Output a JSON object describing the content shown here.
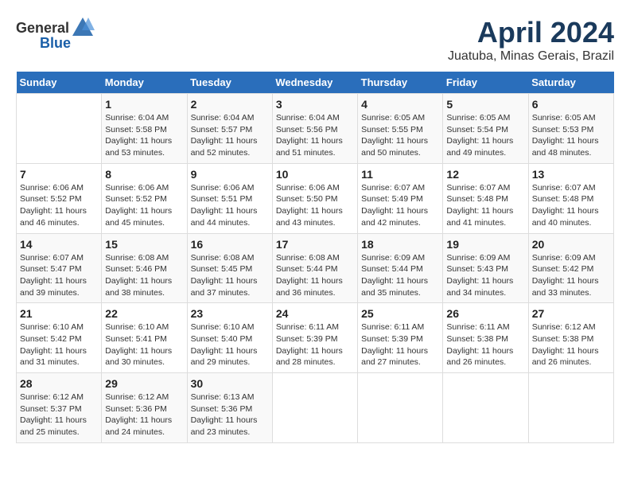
{
  "header": {
    "logo_general": "General",
    "logo_blue": "Blue",
    "title": "April 2024",
    "subtitle": "Juatuba, Minas Gerais, Brazil"
  },
  "columns": [
    "Sunday",
    "Monday",
    "Tuesday",
    "Wednesday",
    "Thursday",
    "Friday",
    "Saturday"
  ],
  "weeks": [
    [
      {
        "day": "",
        "info": ""
      },
      {
        "day": "1",
        "info": "Sunrise: 6:04 AM\nSunset: 5:58 PM\nDaylight: 11 hours\nand 53 minutes."
      },
      {
        "day": "2",
        "info": "Sunrise: 6:04 AM\nSunset: 5:57 PM\nDaylight: 11 hours\nand 52 minutes."
      },
      {
        "day": "3",
        "info": "Sunrise: 6:04 AM\nSunset: 5:56 PM\nDaylight: 11 hours\nand 51 minutes."
      },
      {
        "day": "4",
        "info": "Sunrise: 6:05 AM\nSunset: 5:55 PM\nDaylight: 11 hours\nand 50 minutes."
      },
      {
        "day": "5",
        "info": "Sunrise: 6:05 AM\nSunset: 5:54 PM\nDaylight: 11 hours\nand 49 minutes."
      },
      {
        "day": "6",
        "info": "Sunrise: 6:05 AM\nSunset: 5:53 PM\nDaylight: 11 hours\nand 48 minutes."
      }
    ],
    [
      {
        "day": "7",
        "info": "Sunrise: 6:06 AM\nSunset: 5:52 PM\nDaylight: 11 hours\nand 46 minutes."
      },
      {
        "day": "8",
        "info": "Sunrise: 6:06 AM\nSunset: 5:52 PM\nDaylight: 11 hours\nand 45 minutes."
      },
      {
        "day": "9",
        "info": "Sunrise: 6:06 AM\nSunset: 5:51 PM\nDaylight: 11 hours\nand 44 minutes."
      },
      {
        "day": "10",
        "info": "Sunrise: 6:06 AM\nSunset: 5:50 PM\nDaylight: 11 hours\nand 43 minutes."
      },
      {
        "day": "11",
        "info": "Sunrise: 6:07 AM\nSunset: 5:49 PM\nDaylight: 11 hours\nand 42 minutes."
      },
      {
        "day": "12",
        "info": "Sunrise: 6:07 AM\nSunset: 5:48 PM\nDaylight: 11 hours\nand 41 minutes."
      },
      {
        "day": "13",
        "info": "Sunrise: 6:07 AM\nSunset: 5:48 PM\nDaylight: 11 hours\nand 40 minutes."
      }
    ],
    [
      {
        "day": "14",
        "info": "Sunrise: 6:07 AM\nSunset: 5:47 PM\nDaylight: 11 hours\nand 39 minutes."
      },
      {
        "day": "15",
        "info": "Sunrise: 6:08 AM\nSunset: 5:46 PM\nDaylight: 11 hours\nand 38 minutes."
      },
      {
        "day": "16",
        "info": "Sunrise: 6:08 AM\nSunset: 5:45 PM\nDaylight: 11 hours\nand 37 minutes."
      },
      {
        "day": "17",
        "info": "Sunrise: 6:08 AM\nSunset: 5:44 PM\nDaylight: 11 hours\nand 36 minutes."
      },
      {
        "day": "18",
        "info": "Sunrise: 6:09 AM\nSunset: 5:44 PM\nDaylight: 11 hours\nand 35 minutes."
      },
      {
        "day": "19",
        "info": "Sunrise: 6:09 AM\nSunset: 5:43 PM\nDaylight: 11 hours\nand 34 minutes."
      },
      {
        "day": "20",
        "info": "Sunrise: 6:09 AM\nSunset: 5:42 PM\nDaylight: 11 hours\nand 33 minutes."
      }
    ],
    [
      {
        "day": "21",
        "info": "Sunrise: 6:10 AM\nSunset: 5:42 PM\nDaylight: 11 hours\nand 31 minutes."
      },
      {
        "day": "22",
        "info": "Sunrise: 6:10 AM\nSunset: 5:41 PM\nDaylight: 11 hours\nand 30 minutes."
      },
      {
        "day": "23",
        "info": "Sunrise: 6:10 AM\nSunset: 5:40 PM\nDaylight: 11 hours\nand 29 minutes."
      },
      {
        "day": "24",
        "info": "Sunrise: 6:11 AM\nSunset: 5:39 PM\nDaylight: 11 hours\nand 28 minutes."
      },
      {
        "day": "25",
        "info": "Sunrise: 6:11 AM\nSunset: 5:39 PM\nDaylight: 11 hours\nand 27 minutes."
      },
      {
        "day": "26",
        "info": "Sunrise: 6:11 AM\nSunset: 5:38 PM\nDaylight: 11 hours\nand 26 minutes."
      },
      {
        "day": "27",
        "info": "Sunrise: 6:12 AM\nSunset: 5:38 PM\nDaylight: 11 hours\nand 26 minutes."
      }
    ],
    [
      {
        "day": "28",
        "info": "Sunrise: 6:12 AM\nSunset: 5:37 PM\nDaylight: 11 hours\nand 25 minutes."
      },
      {
        "day": "29",
        "info": "Sunrise: 6:12 AM\nSunset: 5:36 PM\nDaylight: 11 hours\nand 24 minutes."
      },
      {
        "day": "30",
        "info": "Sunrise: 6:13 AM\nSunset: 5:36 PM\nDaylight: 11 hours\nand 23 minutes."
      },
      {
        "day": "",
        "info": ""
      },
      {
        "day": "",
        "info": ""
      },
      {
        "day": "",
        "info": ""
      },
      {
        "day": "",
        "info": ""
      }
    ]
  ]
}
